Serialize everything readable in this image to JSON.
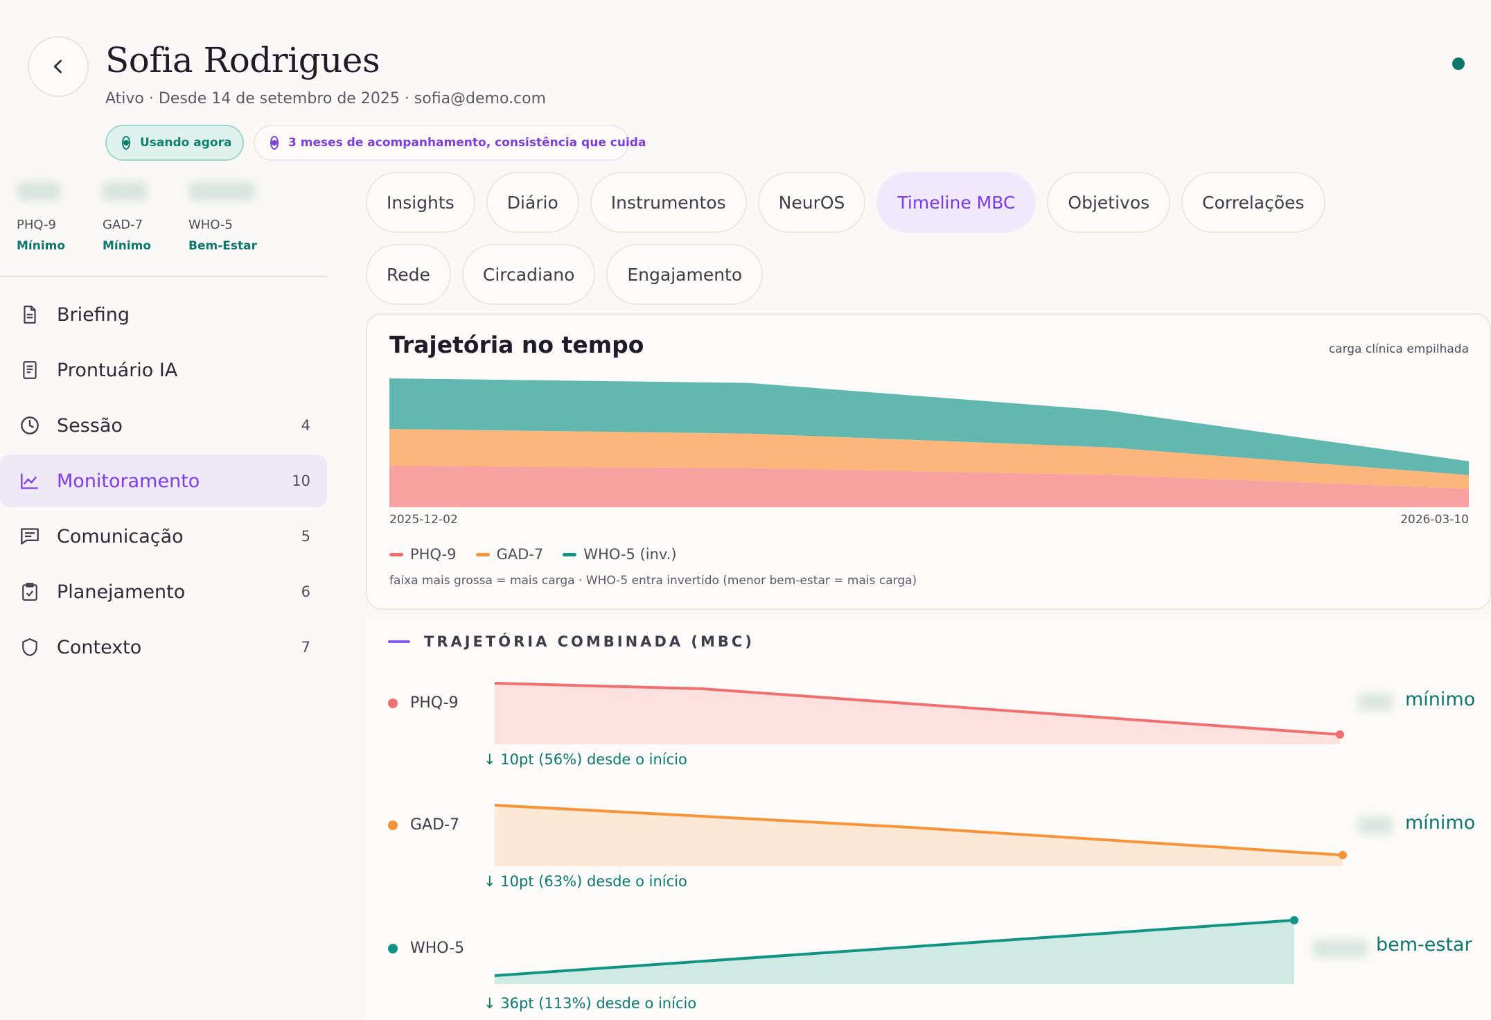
{
  "patient": {
    "name": "Sofia Rodrigues",
    "meta": "Ativo · Desde 14 de setembro de 2025 · sofia@demo.com"
  },
  "badges": {
    "now": "Usando agora",
    "months": "3 meses de acompanhamento, consistência que cuida"
  },
  "scores": [
    {
      "name": "PHQ-9",
      "level": "Mínimo"
    },
    {
      "name": "GAD-7",
      "level": "Mínimo"
    },
    {
      "name": "WHO-5",
      "level": "Bem-Estar"
    }
  ],
  "nav": [
    {
      "label": "Briefing",
      "count": "",
      "icon": "document-icon"
    },
    {
      "label": "Prontuário IA",
      "count": "",
      "icon": "record-icon"
    },
    {
      "label": "Sessão",
      "count": "4",
      "icon": "clock-icon"
    },
    {
      "label": "Monitoramento",
      "count": "10",
      "icon": "chart-line-icon",
      "active": true
    },
    {
      "label": "Comunicação",
      "count": "5",
      "icon": "message-icon"
    },
    {
      "label": "Planejamento",
      "count": "6",
      "icon": "clipboard-check-icon"
    },
    {
      "label": "Contexto",
      "count": "7",
      "icon": "shield-icon"
    }
  ],
  "tabs": [
    {
      "label": "Insights"
    },
    {
      "label": "Diário"
    },
    {
      "label": "Instrumentos"
    },
    {
      "label": "NeurOS"
    },
    {
      "label": "Timeline MBC",
      "active": true
    },
    {
      "label": "Objetivos"
    },
    {
      "label": "Correlações"
    },
    {
      "label": "Rede"
    },
    {
      "label": "Circadiano"
    },
    {
      "label": "Engajamento"
    }
  ],
  "colors": {
    "accent": "#7c3aed",
    "teal": "#0f766e",
    "phq": "#f07070",
    "gad": "#f7943a",
    "who": "#119484"
  },
  "trajectory": {
    "title": "Trajetória no tempo",
    "note": "carga clínica empilhada",
    "date_start": "2025-12-02",
    "date_end": "2026-03-10",
    "legend": [
      "PHQ-9",
      "GAD-7",
      "WHO-5 (inv.)"
    ],
    "footnote": "faixa mais grossa = mais carga · WHO-5 entra invertido (menor bem-estar = mais carga)"
  },
  "combined": {
    "title": "TRAJETÓRIA COMBINADA (MBC)",
    "rows": [
      {
        "name": "PHQ-9",
        "change": "↓ 10pt (56%) desde o início",
        "level": "mínimo"
      },
      {
        "name": "GAD-7",
        "change": "↓ 10pt (63%) desde o início",
        "level": "mínimo"
      },
      {
        "name": "WHO-5",
        "change": "↓ 36pt (113%) desde o início",
        "level": "bem-estar"
      }
    ]
  },
  "chart_data": {
    "type": "area",
    "x": [
      "2025-12-02",
      "2026-01-05",
      "2026-02-08",
      "2026-03-10"
    ],
    "series": [
      {
        "name": "PHQ-9",
        "values": [
          18,
          17,
          14,
          8
        ]
      },
      {
        "name": "GAD-7",
        "values": [
          16,
          15,
          12,
          6
        ]
      },
      {
        "name": "WHO-5 (inv.)",
        "values": [
          22,
          22,
          16,
          6
        ]
      }
    ],
    "xlabel": "",
    "ylabel": "",
    "grid": false,
    "legend": "bottom-left"
  }
}
